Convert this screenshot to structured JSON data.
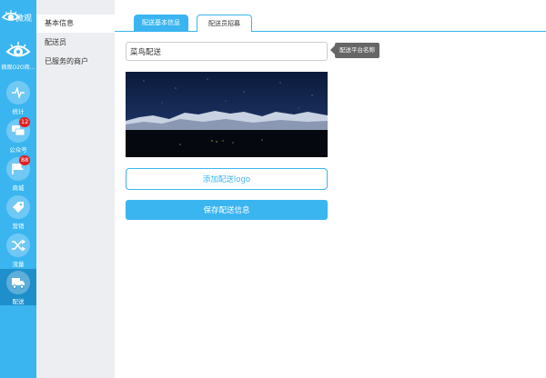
{
  "brand": {
    "name": "微观"
  },
  "account": {
    "name": "微观O2O商..."
  },
  "nav": [
    {
      "key": "stats",
      "label": "统计",
      "icon": "pulse-icon"
    },
    {
      "key": "official",
      "label": "公众号",
      "icon": "chat-icon",
      "badge": "12"
    },
    {
      "key": "mall",
      "label": "商城",
      "icon": "flag-icon",
      "badge": "88"
    },
    {
      "key": "marketing",
      "label": "营销",
      "icon": "tag-icon"
    },
    {
      "key": "traffic",
      "label": "流量",
      "icon": "shuffle-icon"
    },
    {
      "key": "delivery",
      "label": "配送",
      "icon": "truck-icon",
      "active": true
    }
  ],
  "submenu": [
    {
      "label": "基本信息",
      "active": true
    },
    {
      "label": "配送员"
    },
    {
      "label": "已服务的商户"
    }
  ],
  "tabs": [
    {
      "label": "配送基本信息",
      "active": true
    },
    {
      "label": "配送员招募"
    }
  ],
  "form": {
    "name_value": "菜鸟配送",
    "name_tooltip": "配送平台名称",
    "add_logo_label": "添加配送logo",
    "save_label": "保存配送信息"
  },
  "colors": {
    "accent": "#3ab5f0",
    "active_nav": "#1f8fcb",
    "badge": "#e02020"
  }
}
